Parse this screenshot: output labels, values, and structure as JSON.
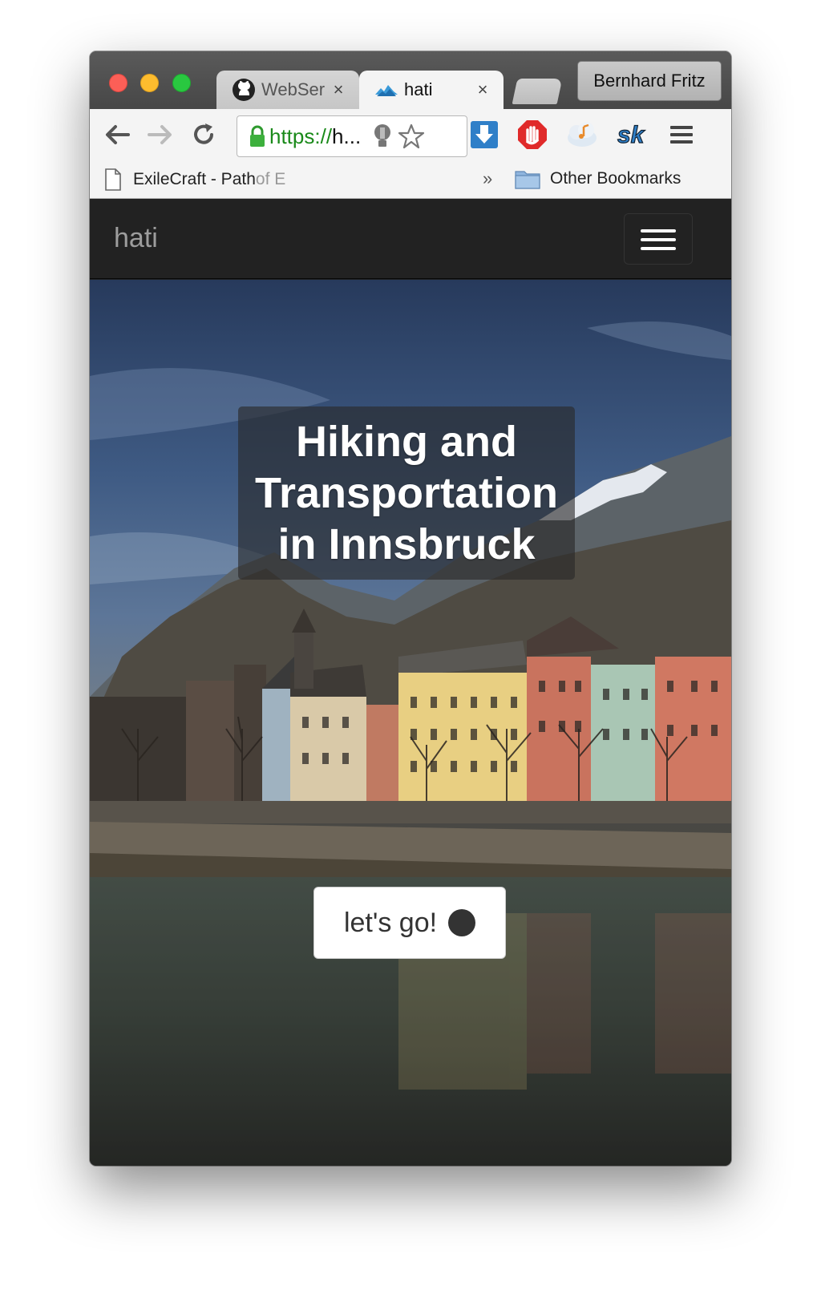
{
  "browser": {
    "tabs": [
      {
        "label": "WebSer",
        "icon": "github-icon"
      },
      {
        "label": "hati",
        "icon": "hati-logo-icon"
      }
    ],
    "tab_close_glyph": "×",
    "profile_name": "Bernhard Fritz",
    "address_bar": {
      "url_secure": "https://",
      "url_rest": "h..."
    },
    "bookmarks": {
      "first": "ExileCraft - Path ",
      "first_fade": "of E",
      "overflow": "»",
      "other": "Other Bookmarks"
    }
  },
  "page": {
    "brand": "hati",
    "headline": [
      "Hiking and",
      "Transportation",
      "in Innsbruck"
    ],
    "cta_label": "let's go!"
  },
  "colors": {
    "navbar": "#222222",
    "brand_text": "#9d9d9d",
    "secure_url": "#1a8a1a"
  }
}
